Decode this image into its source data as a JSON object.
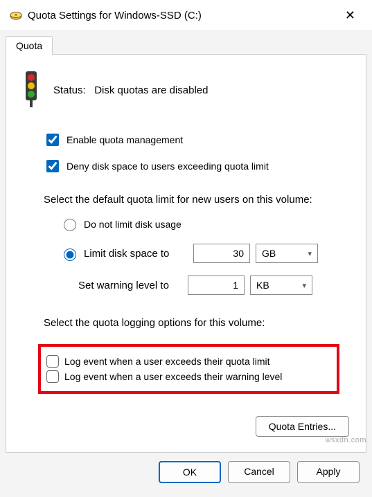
{
  "titlebar": {
    "title": "Quota Settings for Windows-SSD (C:)"
  },
  "tabs": {
    "quota": "Quota"
  },
  "status": {
    "label": "Status:",
    "value": "Disk quotas are disabled"
  },
  "checks": {
    "enable_label": "Enable quota management",
    "deny_label": "Deny disk space to users exceeding quota limit"
  },
  "default_limit_section": {
    "heading": "Select the default quota limit for new users on this volume:",
    "do_not_limit_label": "Do not limit disk usage",
    "limit_label": "Limit disk space to",
    "limit_value": "30",
    "limit_unit": "GB",
    "warning_label": "Set warning level to",
    "warning_value": "1",
    "warning_unit": "KB"
  },
  "logging_section": {
    "heading": "Select the quota logging options for this volume:",
    "log_limit_label": "Log event when a user exceeds their quota limit",
    "log_warning_label": "Log event when a user exceeds their warning level"
  },
  "buttons": {
    "entries": "Quota Entries...",
    "ok": "OK",
    "cancel": "Cancel",
    "apply": "Apply"
  },
  "watermark": "wsxdn.com"
}
